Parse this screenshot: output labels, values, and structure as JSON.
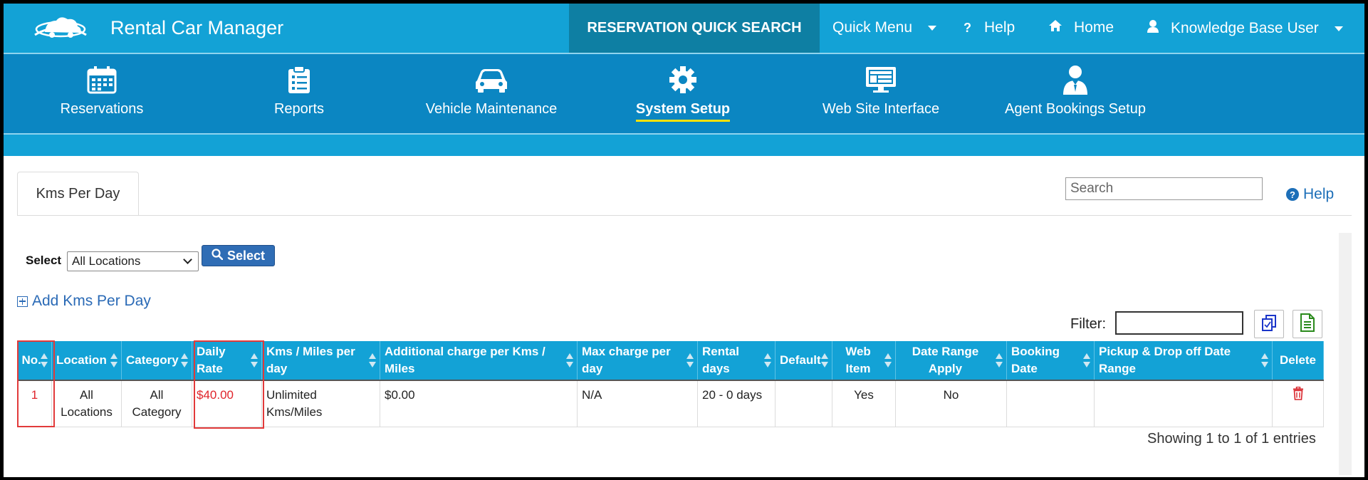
{
  "app": {
    "title": "Rental Car Manager"
  },
  "topnav": {
    "quick_search": "RESERVATION QUICK SEARCH",
    "quick_menu": "Quick Menu",
    "help": "Help",
    "home": "Home",
    "user": "Knowledge Base User"
  },
  "modules": [
    {
      "label": "Reservations",
      "icon": "calendar-icon"
    },
    {
      "label": "Reports",
      "icon": "clipboard-icon"
    },
    {
      "label": "Vehicle Maintenance",
      "icon": "car-icon"
    },
    {
      "label": "System Setup",
      "icon": "gear-icon",
      "active": true
    },
    {
      "label": "Web Site Interface",
      "icon": "monitor-icon"
    },
    {
      "label": "Agent Bookings Setup",
      "icon": "agent-icon"
    }
  ],
  "page": {
    "tab": "Kms Per Day",
    "search_placeholder": "Search",
    "help": "Help",
    "select_label": "Select",
    "location_selected": "All Locations",
    "select_button": "Select",
    "add_link": "Add Kms Per Day",
    "filter_label": "Filter:",
    "filter_value": "",
    "entries_info": "Showing 1 to 1 of 1 entries"
  },
  "table": {
    "headers": [
      "No.",
      "Location",
      "Category",
      "Daily Rate",
      "Kms / Miles per day",
      "Additional charge per Kms / Miles",
      "Max charge per day",
      "Rental days",
      "Default",
      "Web Item",
      "Date Range Apply",
      "Booking Date",
      "Pickup & Drop off Date Range",
      "Delete"
    ],
    "rows": [
      {
        "no": "1",
        "location": "All Locations",
        "category": "All Category",
        "daily_rate": "$40.00",
        "kms_per_day": "Unlimited Kms/Miles",
        "additional_charge": "$0.00",
        "max_charge": "N/A",
        "rental_days": "20 - 0 days",
        "default": "",
        "web_item": "Yes",
        "date_range_apply": "No",
        "booking_date": "",
        "pickup_dropoff_range": ""
      }
    ]
  },
  "colors": {
    "topbar": "#13a2d6",
    "module_nav": "#0b86c2",
    "active_underline": "#ffe100",
    "highlight_box": "#e23a3a",
    "delete_icon": "#d9252b"
  }
}
